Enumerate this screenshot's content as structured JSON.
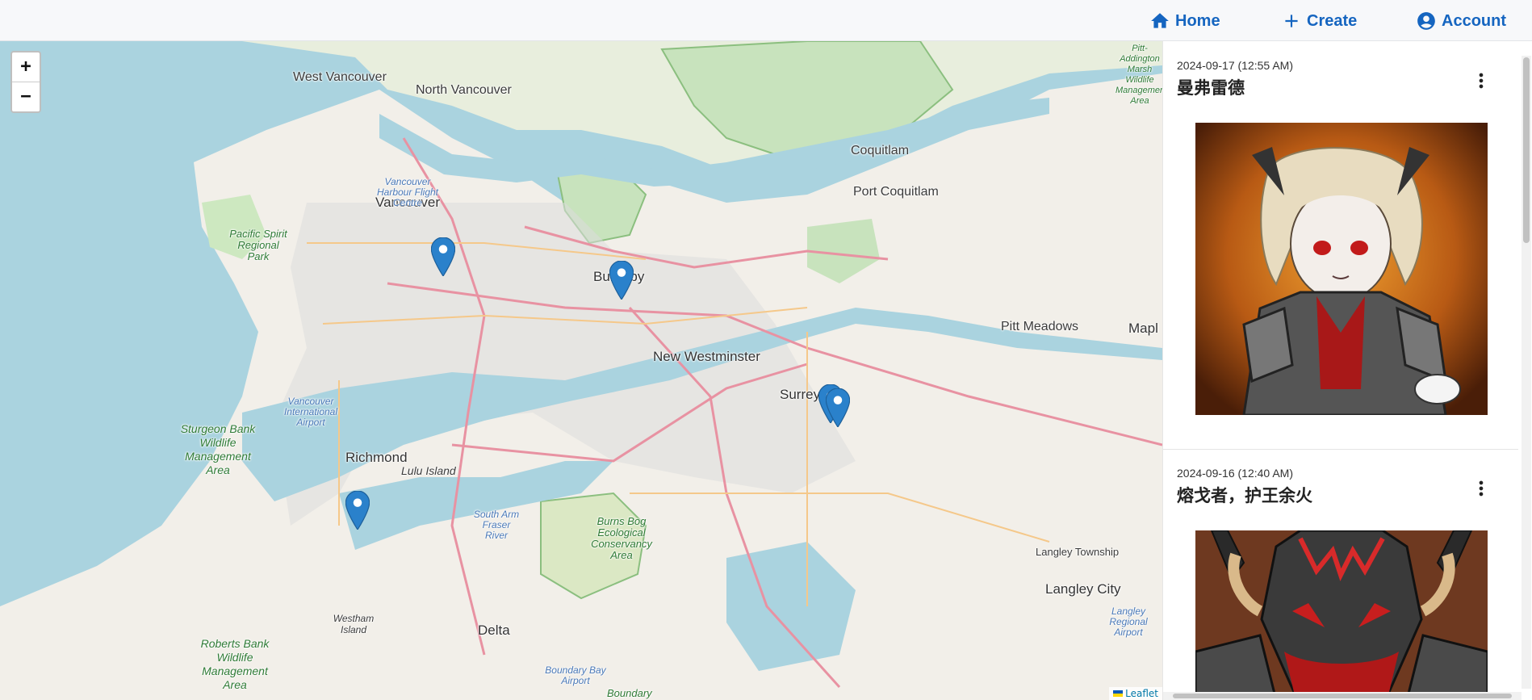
{
  "nav": {
    "home_label": "Home",
    "create_label": "Create",
    "account_label": "Account",
    "accent_color": "#1565c0"
  },
  "map": {
    "zoom_in_label": "+",
    "zoom_out_label": "−",
    "attribution_label": "Leaflet",
    "marker_count": 5,
    "labels": {
      "west_vancouver": "West Vancouver",
      "north_vancouver": "North Vancouver",
      "vancouver": "Vancouver",
      "burnaby": "Burnaby",
      "coquitlam": "Coquitlam",
      "port_coquitlam": "Port Coquitlam",
      "pitt_meadows": "Pitt Meadows",
      "new_westminster": "New Westminster",
      "surrey": "Surrey",
      "richmond": "Richmond",
      "lulu_island": "Lulu Island",
      "delta": "Delta",
      "langley_township": "Langley Township",
      "langley_city": "Langley City",
      "maple": "Mapl",
      "pacific_spirit": "Pacific Spirit Regional Park",
      "sturgeon_bank": "Sturgeon Bank Wildlife Management Area",
      "roberts_bank": "Roberts Bank Wildlife Management Area",
      "burns_bog": "Burns Bog Ecological Conservancy Area",
      "vancouver_airport": "Vancouver International Airport",
      "harbour_flight": "Vancouver Harbour Flight Centre",
      "boundary_bay_airport": "Boundary Bay Airport",
      "south_arm": "South Arm Fraser River",
      "westham_island": "Westham Island",
      "langley_airport": "Langley Regional Airport",
      "pitt_addington": "Pitt-Addington Marsh Wildlife Management Area",
      "boundary": "Boundary"
    }
  },
  "feed": {
    "posts": [
      {
        "date": "2024-09-17 (12:55 AM)",
        "title": "曼弗雷德"
      },
      {
        "date": "2024-09-16 (12:40 AM)",
        "title": "熔戈者，护王余火"
      }
    ]
  }
}
